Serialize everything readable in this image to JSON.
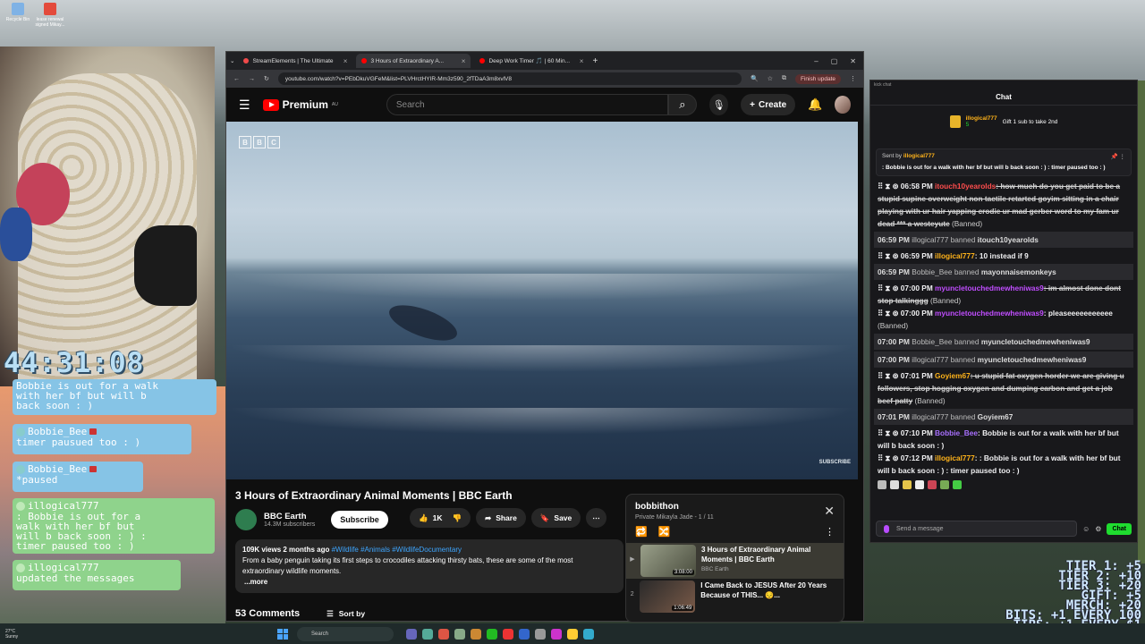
{
  "desktop": {
    "icons": [
      {
        "label": "Recycle Bin",
        "color": "#7fb2e5"
      },
      {
        "label": "lease renewal signed Mikay...",
        "color": "#e34a3b"
      }
    ]
  },
  "stream_overlay": {
    "timer": "44:31:08",
    "messages": [
      {
        "user": "Bobbie_Bee",
        "text": "Bobbie is out for a walk\nwith her bf but will b\nback soon : )",
        "style": "blue"
      },
      {
        "user": "Bobbie_Bee",
        "text": "timer pausued too : )",
        "style": "blue"
      },
      {
        "user": "Bobbie_Bee",
        "text": "*paused",
        "style": "blue"
      },
      {
        "user": "illogical777",
        "text": ": Bobbie is out for a\nwalk with her bf but\nwill b back soon : ) :\ntimer paused too : )",
        "style": "green"
      },
      {
        "user": "illogical777",
        "text": "updated the messages",
        "style": "green"
      }
    ],
    "tiers": [
      "TIER 1: +5",
      "TIER 2: +10",
      "TIER 3: +20",
      "GIFT: +5",
      "MERCH: +20",
      "BITS: +1 EVERY 100",
      "TIPS: +1 EVERY $1"
    ]
  },
  "browser": {
    "tabs": [
      {
        "title": "StreamElements | The Ultimate",
        "color": "#f04a4a",
        "active": false
      },
      {
        "title": "3 Hours of Extraordinary A...",
        "color": "#ff0000",
        "active": true
      },
      {
        "title": "Deep Work Timer 🎵 | 60 Min...",
        "color": "#ff0000",
        "active": false
      }
    ],
    "new_tab": "+",
    "url": "youtube.com/watch?v=PEbDkuVGFeM&list=PLVHrctHYIR-Mm3z590_2fTDaA3m8xvlV8",
    "finish_update": "Finish update"
  },
  "youtube": {
    "logo_text": "Premium",
    "logo_region": "AU",
    "search_placeholder": "Search",
    "create_label": "Create",
    "player": {
      "watermark": [
        "B",
        "B",
        "C"
      ],
      "subscribe_watermark": "SUBSCRIBE"
    },
    "video_title": "3 Hours of Extraordinary Animal Moments | BBC Earth",
    "channel": {
      "name": "BBC Earth",
      "subscribers": "14.3M subscribers"
    },
    "subscribe_label": "Subscribe",
    "likes": "1K",
    "share_label": "Share",
    "save_label": "Save",
    "description": {
      "meta": "109K views  2 months ago",
      "tags": "#Wildlife #Animals #WildlifeDocumentary",
      "text": "From a baby penguin taking its first steps to crocodiles attacking thirsty bats, these are some of the most extraordinary wildlife moments.",
      "more": "...more"
    },
    "comments_count": "53 Comments",
    "sort_by": "Sort by",
    "playlist": {
      "title": "bobbithon",
      "subtitle": "Private  Mikayla Jade - 1 / 11",
      "items": [
        {
          "index": "▶",
          "title": "3 Hours of Extraordinary Animal Moments | BBC Earth",
          "channel": "BBC Earth",
          "duration": "3:08:00"
        },
        {
          "index": "2",
          "title": "I Came Back to JESUS After 20 Years Because of THIS... 😔...",
          "channel": "",
          "duration": "1:06:49"
        }
      ]
    }
  },
  "chat": {
    "window_title": "kick chat",
    "header": "Chat",
    "gift": {
      "user": "illogical777",
      "count": "5",
      "text": "Gift 1 sub to take 2nd"
    },
    "pinned": {
      "sent_by_prefix": "Sent by",
      "sent_by_user": "illogical777",
      "text": ": Bobbie is out for a walk with her bf but will b back soon : ) : timer paused too : )"
    },
    "lines": [
      {
        "kind": "msg",
        "time": "06:58 PM",
        "user": "itouch10yearolds",
        "user_color": "#ff4d4d",
        "text": ": how much do you get paid to be a stupid supine overweight non tactile retarted goyim sitting in a chair playing with ur hair yapping crodie ur mad gerber word to my fam ur dead *** a westeyute",
        "struck": true,
        "tag": "(Banned)"
      },
      {
        "kind": "sys",
        "time": "06:59 PM",
        "actor": "illogical777",
        "verb": "banned",
        "target": "itouch10yearolds"
      },
      {
        "kind": "msg",
        "time": "06:59 PM",
        "user": "illogical777",
        "user_color": "#ffb31a",
        "text": ": 10 instead if 9",
        "struck": false,
        "tag": ""
      },
      {
        "kind": "sys",
        "time": "06:59 PM",
        "actor": "Bobbie_Bee",
        "verb": "banned",
        "target": "mayonnaisemonkeys"
      },
      {
        "kind": "msg",
        "time": "07:00 PM",
        "user": "myuncletouchedmewheniwas9",
        "user_color": "#c04dff",
        "text": ": im almost done dont stop talkinggg",
        "struck": true,
        "tag": "(Banned)"
      },
      {
        "kind": "msg",
        "time": "07:00 PM",
        "user": "myuncletouchedmewheniwas9",
        "user_color": "#c04dff",
        "text": ": pleaseeeeeeeeeee",
        "struck": false,
        "tag": "(Banned)"
      },
      {
        "kind": "sys",
        "time": "07:00 PM",
        "actor": "Bobbie_Bee",
        "verb": "banned",
        "target": "myuncletouchedmewheniwas9"
      },
      {
        "kind": "sys",
        "time": "07:00 PM",
        "actor": "illogical777",
        "verb": "banned",
        "target": "myuncletouchedmewheniwas9"
      },
      {
        "kind": "msg",
        "time": "07:01 PM",
        "user": "Goyiem67",
        "user_color": "#ffb31a",
        "text": ": u stupid fat oxygen horder we are giving u followers, stop hogging oxygen and dumping carbon and get a job beef patty",
        "struck": true,
        "tag": "(Banned)"
      },
      {
        "kind": "sys",
        "time": "07:01 PM",
        "actor": "illogical777",
        "verb": "banned",
        "target": "Goyiem67"
      },
      {
        "kind": "msg",
        "time": "07:10 PM",
        "user": "Bobbie_Bee",
        "user_color": "#a970ff",
        "text": ": Bobbie is out for a walk with her bf but will b back soon : )",
        "struck": false,
        "tag": ""
      },
      {
        "kind": "msg",
        "time": "07:12 PM",
        "user": "illogical777",
        "user_color": "#ffb31a",
        "text": ": : Bobbie is out for a walk with her bf but will b back soon : ) : timer paused too : )",
        "struck": false,
        "tag": ""
      }
    ],
    "input_placeholder": "Send a message",
    "send_label": "Chat"
  },
  "taskbar": {
    "weather": [
      "27°C",
      "Sunny"
    ],
    "search_placeholder": "Search"
  }
}
